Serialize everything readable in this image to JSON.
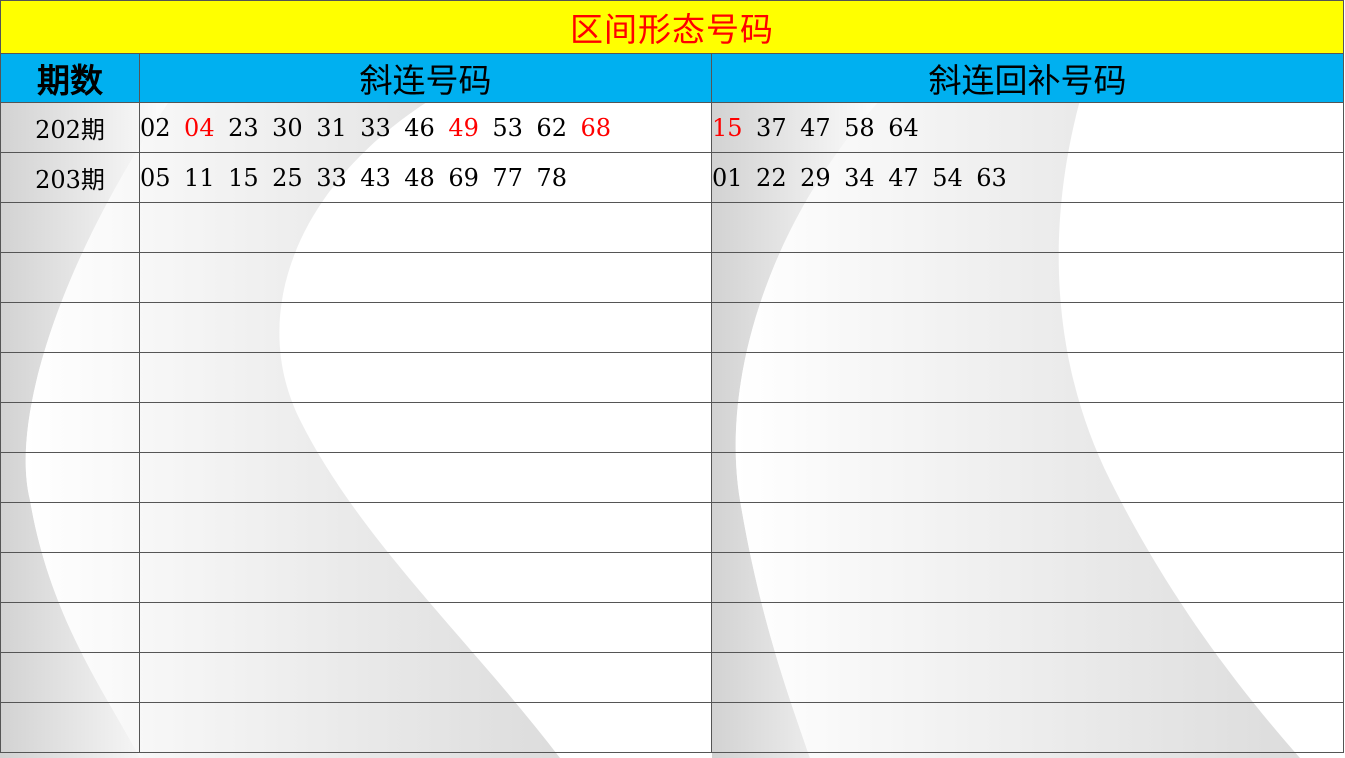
{
  "title": "区间形态号码",
  "headers": {
    "period": "期数",
    "col1": "斜连号码",
    "col2": "斜连回补号码"
  },
  "colors": {
    "title_bg": "#ffff00",
    "title_text": "#ff0000",
    "header_bg": "#00b0f0",
    "highlight": "#ff0000"
  },
  "rows": [
    {
      "period": "202期",
      "col1": [
        {
          "n": "02",
          "red": false
        },
        {
          "n": "04",
          "red": true
        },
        {
          "n": "23",
          "red": false
        },
        {
          "n": "30",
          "red": false
        },
        {
          "n": "31",
          "red": false
        },
        {
          "n": "33",
          "red": false
        },
        {
          "n": "46",
          "red": false
        },
        {
          "n": "49",
          "red": true
        },
        {
          "n": "53",
          "red": false
        },
        {
          "n": "62",
          "red": false
        },
        {
          "n": "68",
          "red": true
        }
      ],
      "col2": [
        {
          "n": "15",
          "red": true
        },
        {
          "n": "37",
          "red": false
        },
        {
          "n": "47",
          "red": false
        },
        {
          "n": "58",
          "red": false
        },
        {
          "n": "64",
          "red": false
        }
      ]
    },
    {
      "period": "203期",
      "col1": [
        {
          "n": "05",
          "red": false
        },
        {
          "n": "11",
          "red": false
        },
        {
          "n": "15",
          "red": false
        },
        {
          "n": "25",
          "red": false
        },
        {
          "n": "33",
          "red": false
        },
        {
          "n": "43",
          "red": false
        },
        {
          "n": "48",
          "red": false
        },
        {
          "n": "69",
          "red": false
        },
        {
          "n": "77",
          "red": false
        },
        {
          "n": "78",
          "red": false
        }
      ],
      "col2": [
        {
          "n": "01",
          "red": false
        },
        {
          "n": "22",
          "red": false
        },
        {
          "n": "29",
          "red": false
        },
        {
          "n": "34",
          "red": false
        },
        {
          "n": "47",
          "red": false
        },
        {
          "n": "54",
          "red": false
        },
        {
          "n": "63",
          "red": false
        }
      ]
    }
  ],
  "empty_rows": 11
}
